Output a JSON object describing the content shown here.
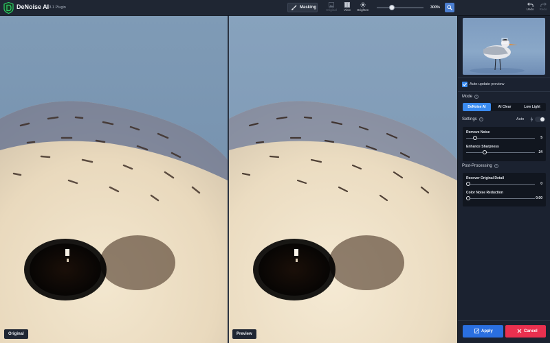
{
  "header": {
    "app_title": "DeNoise AI",
    "app_version": "v2.3.1 Plugin",
    "masking_label": "Masking",
    "tools": [
      {
        "label": "Original",
        "icon": "image-icon",
        "enabled": false
      },
      {
        "label": "View",
        "icon": "split-view-icon",
        "enabled": true
      },
      {
        "label": "Brighten",
        "icon": "sun-icon",
        "enabled": true
      }
    ],
    "zoom_value": "300%",
    "zoom_level_fraction": 0.26,
    "undo_label": "Undo",
    "redo_label": "Redo"
  },
  "viewer": {
    "left_label": "Original",
    "right_label": "Preview"
  },
  "sidebar": {
    "auto_update_label": "Auto-update preview",
    "auto_update_checked": true,
    "mode_label": "Mode",
    "modes": [
      {
        "label": "DeNoise AI",
        "active": true
      },
      {
        "label": "AI Clear",
        "active": false
      },
      {
        "label": "Low Light",
        "active": false
      }
    ],
    "settings_label": "Settings",
    "auto_label": "Auto",
    "auto_enabled": false,
    "settings_sliders": [
      {
        "name": "Remove Noise",
        "value": "5",
        "fraction": 0.1
      },
      {
        "name": "Enhance Sharpness",
        "value": "24",
        "fraction": 0.24
      }
    ],
    "post_processing_label": "Post-Processing",
    "post_sliders": [
      {
        "name": "Recover Original Detail",
        "value": "0",
        "fraction": 0.0
      },
      {
        "name": "Color Noise Reduction",
        "value": "0.00",
        "fraction": 0.0
      }
    ],
    "apply_label": "Apply",
    "cancel_label": "Cancel"
  },
  "colors": {
    "accent": "#3a8bf0",
    "apply": "#2a6fe0",
    "cancel": "#e9304f",
    "background": "#1b2230"
  }
}
